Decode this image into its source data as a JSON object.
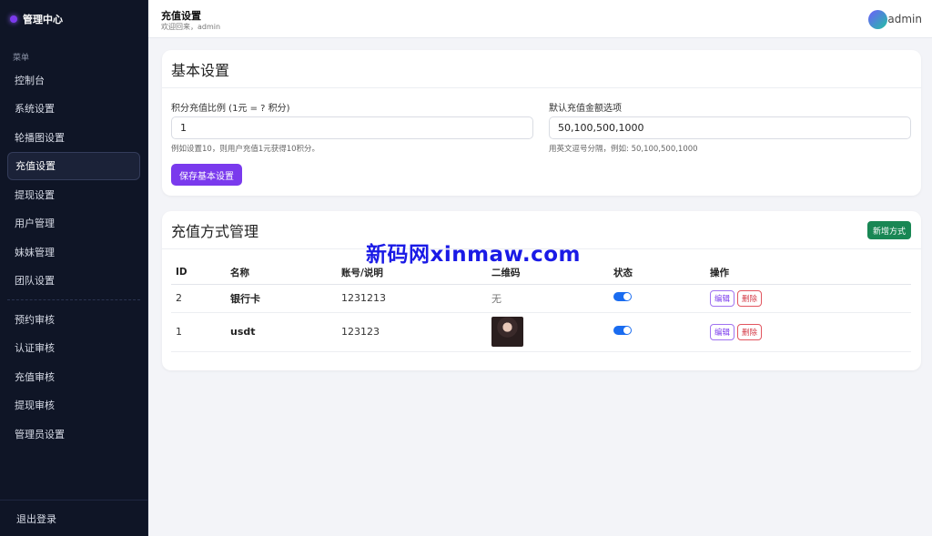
{
  "sidebar": {
    "brand": "管理中心",
    "menu_title": "菜单",
    "items_top": [
      {
        "label": "控制台"
      },
      {
        "label": "系统设置"
      },
      {
        "label": "轮播图设置"
      },
      {
        "label": "充值设置",
        "active": true
      },
      {
        "label": "提现设置"
      },
      {
        "label": "用户管理"
      },
      {
        "label": "妹妹管理"
      },
      {
        "label": "团队设置"
      }
    ],
    "items_bottom": [
      {
        "label": "预约审核"
      },
      {
        "label": "认证审核"
      },
      {
        "label": "充值审核"
      },
      {
        "label": "提现审核"
      },
      {
        "label": "管理员设置"
      }
    ],
    "logout": "退出登录"
  },
  "header": {
    "title": "充值设置",
    "subtitle": "欢迎回来，admin",
    "user": "admin"
  },
  "basic": {
    "title": "基本设置",
    "ratio_label": "积分充值比例 (1元 = ? 积分)",
    "ratio_value": "1",
    "ratio_help": "例如设置10，则用户充值1元获得10积分。",
    "amount_label": "默认充值金额选项",
    "amount_value": "50,100,500,1000",
    "amount_help": "用英文逗号分隔，例如: 50,100,500,1000",
    "save_label": "保存基本设置"
  },
  "methods": {
    "title": "充值方式管理",
    "add_label": "新增方式",
    "columns": [
      "ID",
      "名称",
      "账号/说明",
      "二维码",
      "状态",
      "操作"
    ],
    "rows": [
      {
        "id": "2",
        "name": "银行卡",
        "account": "1231213",
        "qr": "无",
        "enabled": true
      },
      {
        "id": "1",
        "name": "usdt",
        "account": "123123",
        "qr": "",
        "enabled": true
      }
    ],
    "edit_label": "编辑",
    "delete_label": "删除"
  },
  "watermark": "新码网xinmaw.com",
  "colors": {
    "accent": "#7a3aed",
    "success": "#198754",
    "toggle": "#1a6cf0",
    "danger": "#d43b47",
    "sidebar_bg": "#0f1526"
  }
}
